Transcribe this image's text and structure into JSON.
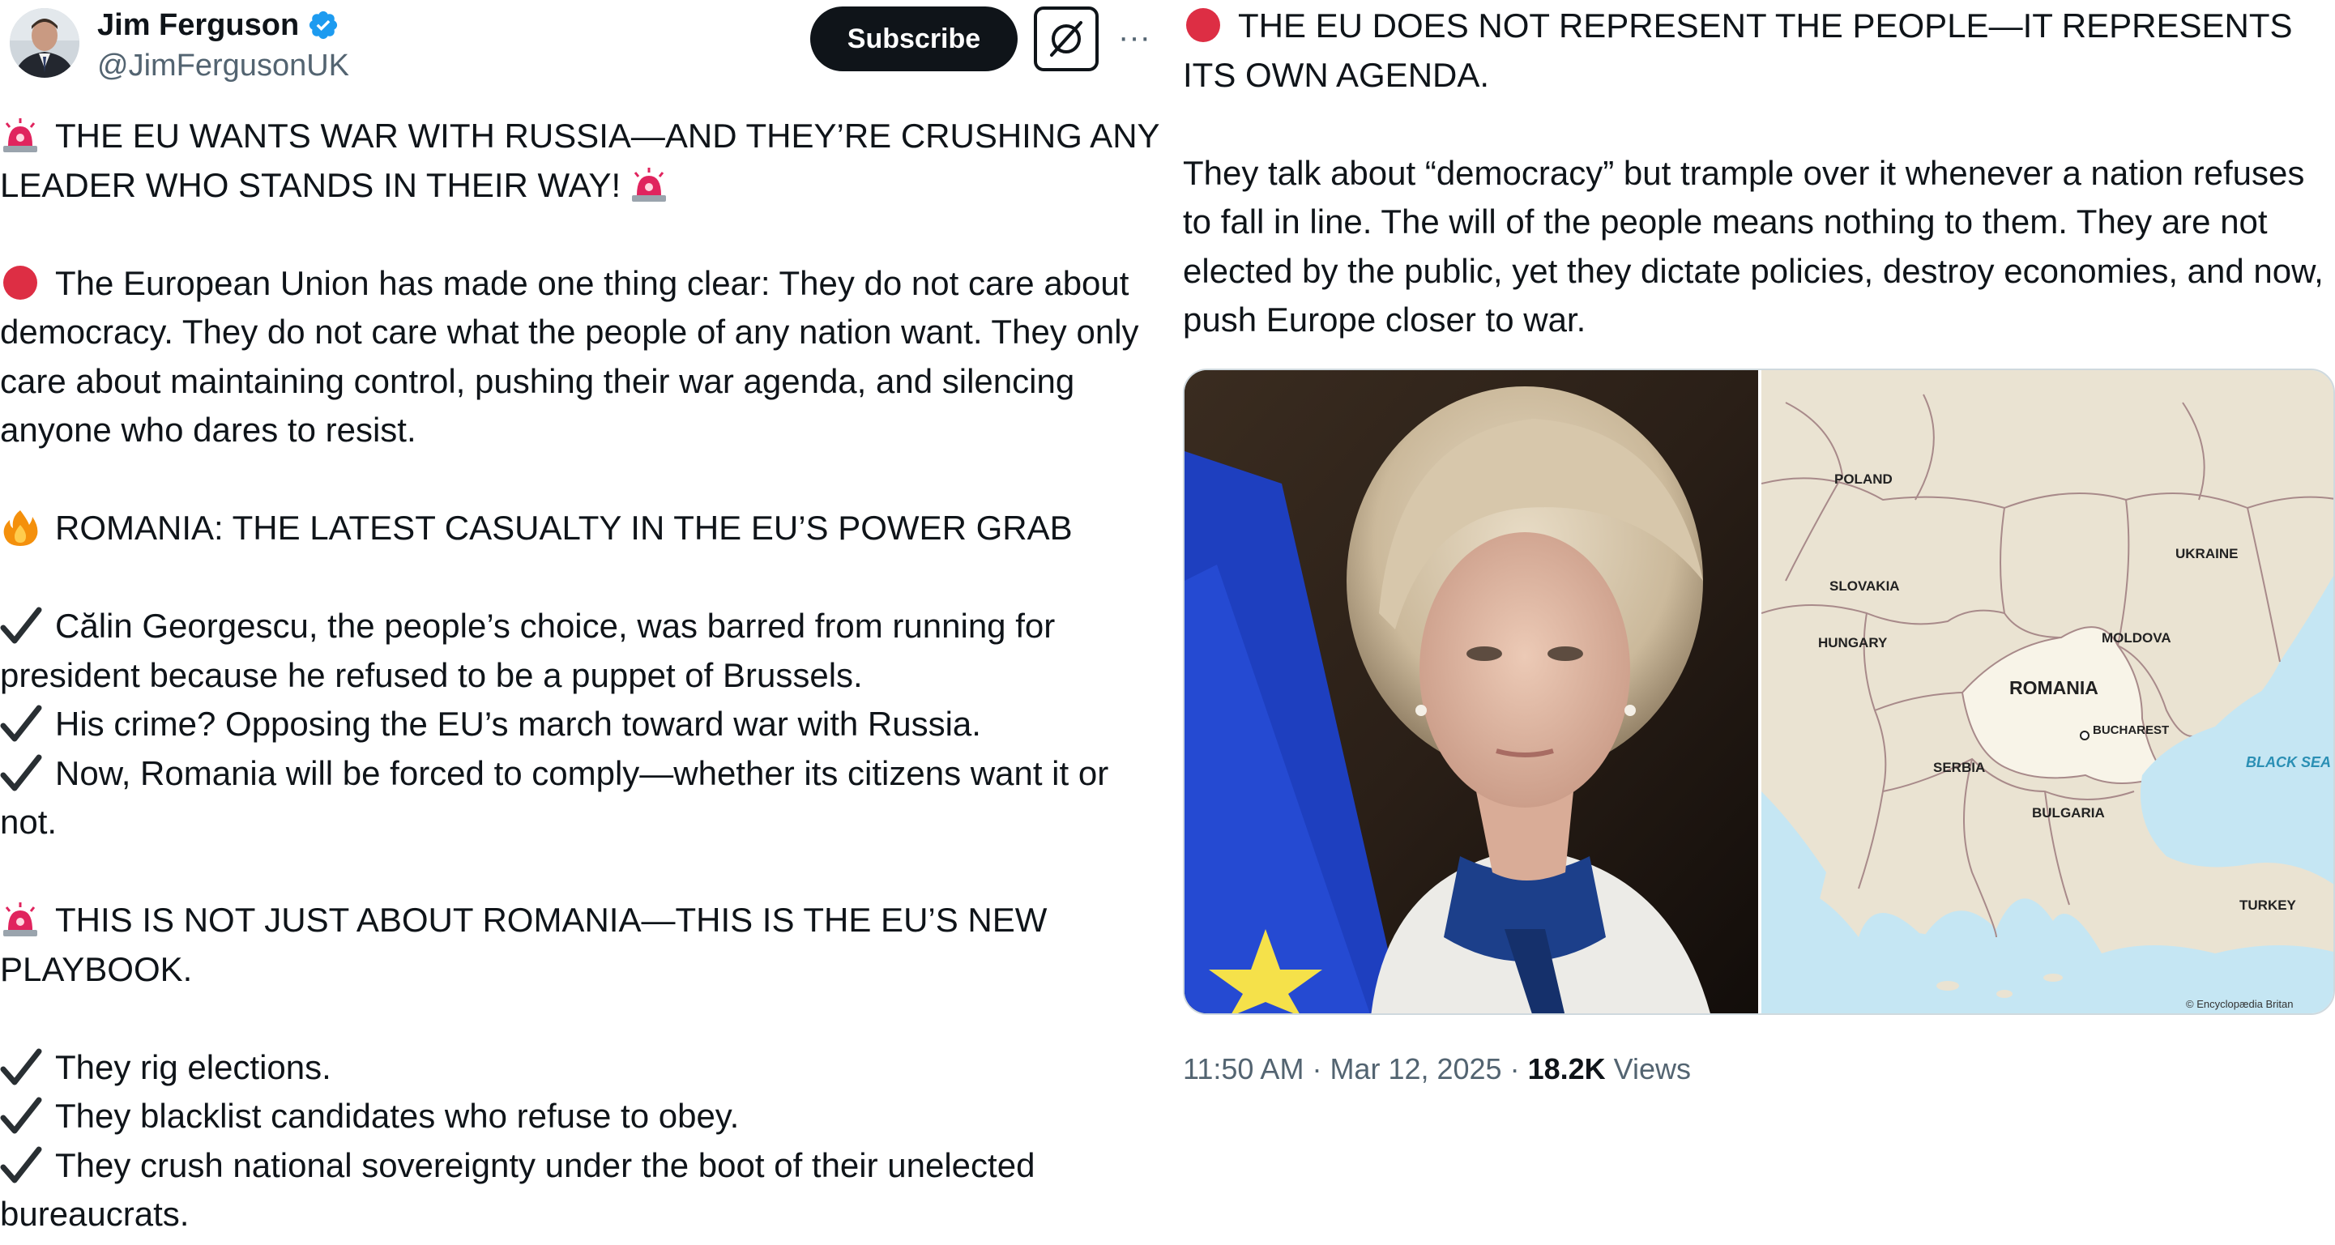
{
  "author": {
    "display_name": "Jim Ferguson",
    "handle": "@JimFergusonUK",
    "verified_icon": "verified-badge-icon",
    "verified_color": "#1d9bf0"
  },
  "actions": {
    "subscribe_label": "Subscribe",
    "grok_icon": "grok-icon",
    "more_label": "···"
  },
  "post": {
    "headline_1": "THE EU WANTS WAR WITH RUSSIA—AND THEY’RE CRUSHING ANY LEADER WHO STANDS IN THEIR WAY!",
    "para_1": "The European Union has made one thing clear: They do not care about democracy. They do not care what the people of any nation want. They only care about maintaining control, pushing their war agenda, and silencing anyone who dares to resist.",
    "headline_2": "ROMANIA: THE LATEST CASUALTY IN THE EU’S POWER GRAB",
    "checks_1": [
      "Călin Georgescu, the people’s choice, was barred from running for president because he refused to be a puppet of Brussels.",
      "His crime? Opposing the EU’s march toward war with Russia.",
      "Now, Romania will be forced to comply—whether its citizens want it or not."
    ],
    "headline_3": "THIS IS NOT JUST ABOUT ROMANIA—THIS IS THE EU’S NEW PLAYBOOK.",
    "checks_2": [
      "They rig elections.",
      "They blacklist candidates who refuse to obey.",
      "They crush national sovereignty under the boot of their unelected bureaucrats."
    ],
    "headline_4": "THE EU DOES NOT REPRESENT THE PEOPLE—IT REPRESENTS ITS OWN AGENDA.",
    "para_2": "They talk about “democracy” but trample over it whenever a nation refuses to fall in line. The will of the people means nothing to them. They are not elected by the public, yet they dictate policies, destroy economies, and now, push Europe closer to war."
  },
  "map": {
    "labels": {
      "poland": "POLAND",
      "ukraine": "UKRAINE",
      "slovakia": "SLOVAKIA",
      "hungary": "HUNGARY",
      "moldova": "MOLDOVA",
      "romania": "ROMANIA",
      "bucharest": "BUCHAREST",
      "serbia": "SERBIA",
      "bulgaria": "BULGARIA",
      "black_sea": "BLACK SEA",
      "turkey": "TURKEY",
      "credit": "© Encyclopædia Britan"
    },
    "colors": {
      "sea": "#c5e6f3",
      "land": "#eae3d2",
      "highlight": "#f8f4e8",
      "border": "#a88a8a"
    }
  },
  "meta": {
    "time": "11:50 AM",
    "sep1": " · ",
    "date": "Mar 12, 2025",
    "sep2": " · ",
    "views_count": "18.2K",
    "views_label": " Views"
  },
  "icons": {
    "siren": "siren-emoji-icon",
    "red_circle": "red-circle-emoji-icon",
    "fire": "fire-emoji-icon",
    "check": "check-mark-icon"
  }
}
